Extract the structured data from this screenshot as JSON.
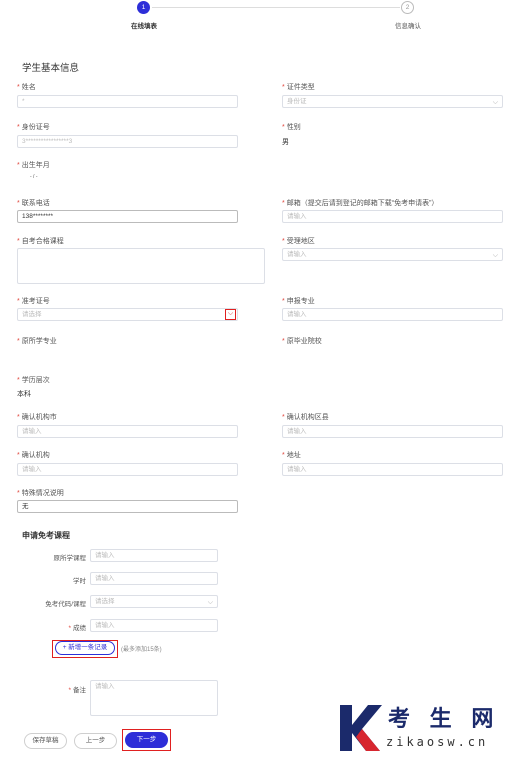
{
  "steps": [
    {
      "num": "1",
      "label": "在线填表"
    },
    {
      "num": "2",
      "label": "信息确认"
    }
  ],
  "section_basic": "学生基本信息",
  "fields": {
    "name": {
      "label": "姓名",
      "value": "*"
    },
    "id_type": {
      "label": "证件类型",
      "value": "身份证"
    },
    "id_number": {
      "label": "身份证号",
      "value": "3*****************3"
    },
    "gender": {
      "label": "性别",
      "value": "男"
    },
    "birth": {
      "label": "出生年月",
      "value": "- / -"
    },
    "phone": {
      "label": "联系电话",
      "value": "138********"
    },
    "email": {
      "label": "邮箱（提交后请到登记的邮箱下载“免考申请表”）",
      "placeholder": "请输入"
    },
    "passed_courses": {
      "label": "自考合格课程"
    },
    "region": {
      "label": "受理地区",
      "placeholder": "请输入"
    },
    "exam_no": {
      "label": "准考证号",
      "placeholder": "请选择"
    },
    "apply_major": {
      "label": "申报专业",
      "placeholder": "请输入"
    },
    "orig_major": {
      "label": "原所学专业"
    },
    "orig_school": {
      "label": "原毕业院校"
    },
    "education": {
      "label": "学历层次",
      "value": "本科"
    },
    "cert_city": {
      "label": "确认机构市",
      "placeholder": "请输入"
    },
    "cert_district": {
      "label": "确认机构区县",
      "placeholder": "请输入"
    },
    "cert_org": {
      "label": "确认机构",
      "placeholder": "请输入"
    },
    "address": {
      "label": "地址",
      "placeholder": "请输入"
    },
    "special": {
      "label": "特殊情况说明",
      "value": "无"
    }
  },
  "section_exempt": "申请免考课程",
  "exempt": {
    "orig_course": {
      "label": "原所学课程",
      "placeholder": "请输入"
    },
    "hours": {
      "label": "学时",
      "placeholder": "请输入"
    },
    "code": {
      "label": "免考代码/课程",
      "placeholder": "请选择"
    },
    "score": {
      "label": "成绩",
      "placeholder": "请输入"
    },
    "add_button": "+ 新增一条记录",
    "add_hint": "(最多添加15条)",
    "remark": {
      "label": "备注",
      "placeholder": "请输入"
    }
  },
  "buttons": {
    "save": "保存草稿",
    "prev": "上一步",
    "next": "下一步"
  },
  "watermark": {
    "brand": "考 生 网",
    "url": "zikaosw.cn"
  },
  "colors": {
    "accent": "#2d2ed8",
    "required": "#e0443a",
    "highlight": "#e02020"
  }
}
